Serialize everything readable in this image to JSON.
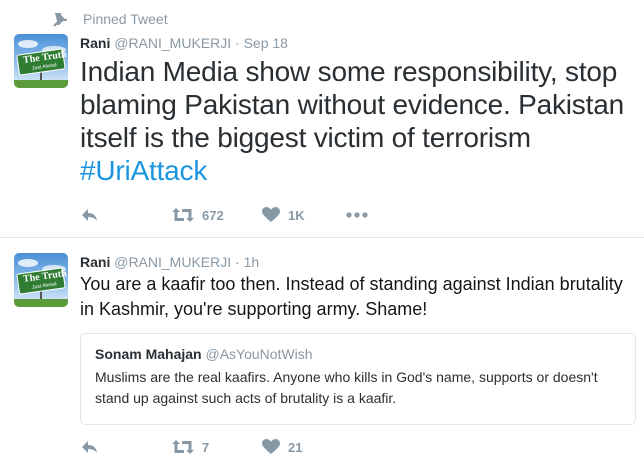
{
  "tweets": [
    {
      "pinned_label": "Pinned Tweet",
      "name": "Rani",
      "handle": "@RANI_MUKERJI",
      "separator": "·",
      "time": "Sep 18",
      "avatar_sign_text": "The Truth",
      "avatar_sign_subtext": "Just Ahead",
      "text": "Indian Media show some responsibility, stop blaming Pakistan without evidence. Pakistan itself is the biggest victim of terrorism ",
      "hashtag": "#UriAttack",
      "retweets": "672",
      "likes": "1K"
    },
    {
      "name": "Rani",
      "handle": "@RANI_MUKERJI",
      "separator": "·",
      "time": "1h",
      "avatar_sign_text": "The Truth",
      "avatar_sign_subtext": "Just Ahead",
      "text": "You are a kaafir too then. Instead of standing against Indian brutality in Kashmir, you're supporting army. Shame!",
      "quote": {
        "name": "Sonam Mahajan",
        "handle": "@AsYouNotWish",
        "text": "Muslims are the real kaafirs. Anyone who kills in God's name, supports or doesn't stand up against such acts of brutality is a kaafir."
      },
      "retweets": "7",
      "likes": "21"
    }
  ],
  "icons": {
    "pin": "pin-icon",
    "reply": "reply-icon",
    "retweet": "retweet-icon",
    "like": "heart-icon",
    "more": "more-icon"
  },
  "colors": {
    "text": "#292f33",
    "muted": "#8899a6",
    "link": "#1b95e0",
    "border": "#e1e8ed",
    "sign_green": "#2e7d32"
  }
}
